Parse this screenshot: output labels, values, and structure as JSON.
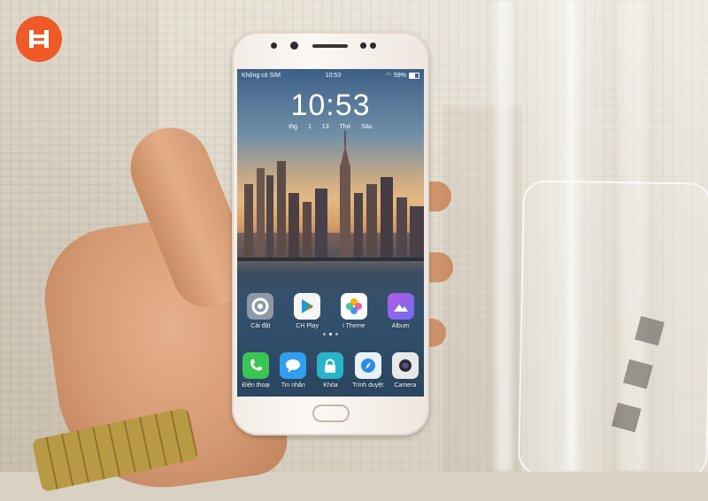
{
  "brand": {
    "logo_color": "#f05a28"
  },
  "phone": {
    "status_bar": {
      "carrier": "Không có SIM",
      "time": "10:53",
      "battery": "59%",
      "icons": [
        "wifi-icon",
        "battery-icon"
      ]
    },
    "lock_clock": {
      "time": "10:53",
      "date": "thg 1 13",
      "weekday": "Thứ Sáu"
    },
    "apps": [
      {
        "label": "Cài đặt",
        "icon": "settings-icon"
      },
      {
        "label": "CH Play",
        "icon": "play-store-icon"
      },
      {
        "label": "i Theme",
        "icon": "theme-icon"
      },
      {
        "label": "Album",
        "icon": "album-icon"
      }
    ],
    "page_indicator": {
      "pages": 3,
      "current": 2
    },
    "dock": [
      {
        "label": "Điện thoại",
        "icon": "phone-icon"
      },
      {
        "label": "Tin nhắn",
        "icon": "message-icon"
      },
      {
        "label": "Khóa",
        "icon": "lock-icon"
      },
      {
        "label": "Trình duyệt",
        "icon": "browser-icon"
      },
      {
        "label": "Camera",
        "icon": "camera-icon"
      }
    ]
  }
}
